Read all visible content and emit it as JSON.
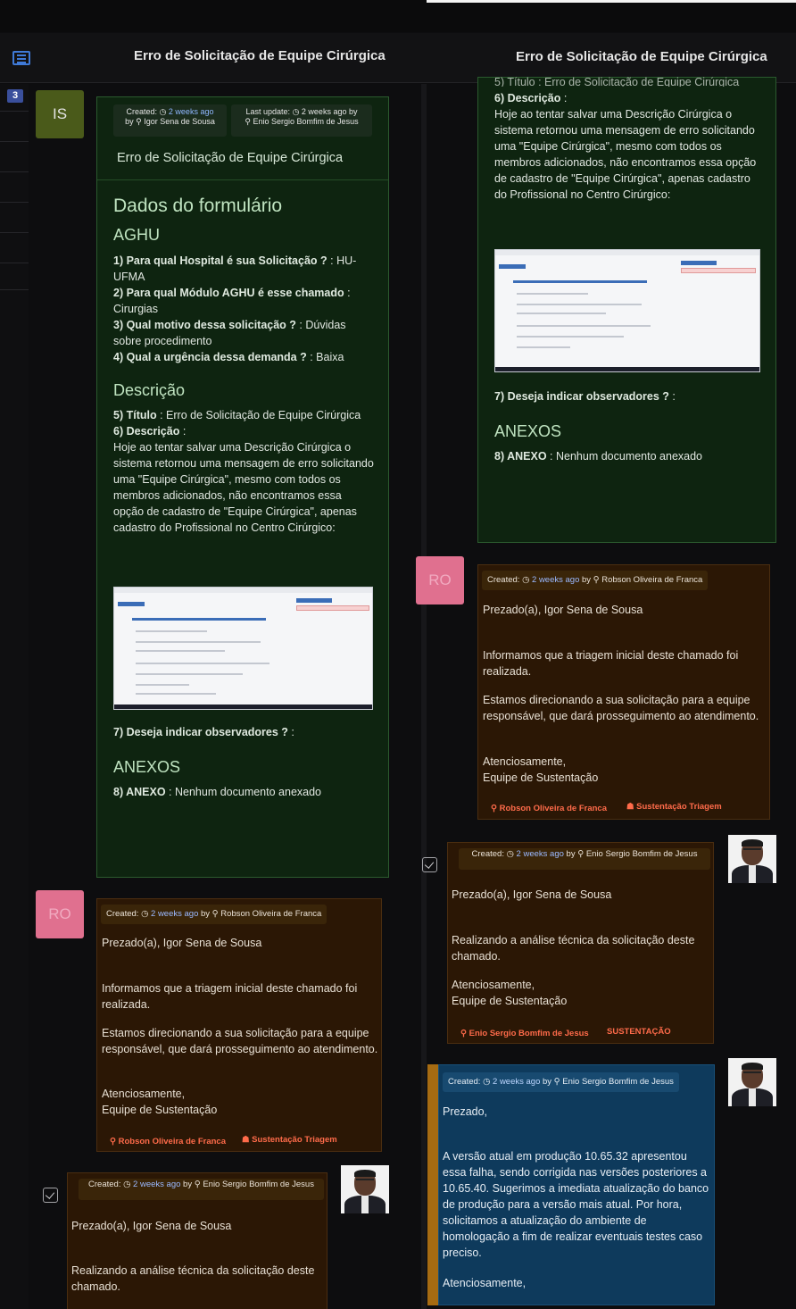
{
  "header": {
    "title_left": "Erro de Solicitação de Equipe Cirúrgica",
    "title_right": "Erro de Solicitação de Equipe Cirúrgica"
  },
  "rail": {
    "badge": "3"
  },
  "ticket": {
    "avatar_initials": "IS",
    "created_label": "Created:",
    "created_time": "2 weeks ago",
    "created_by_prefix": "by",
    "created_by": "Igor Sena de Sousa",
    "last_update_label": "Last update:",
    "last_update_time": "2 weeks ago by",
    "last_update_by": "Enio Sergio Bomfim de Jesus",
    "title": "Erro de Solicitação de Equipe Cirúrgica",
    "form_heading": "Dados do formulário",
    "section_aghu": "AGHU",
    "q1": "1) Para qual Hospital é sua Solicitação ?",
    "a1": " : HU-UFMA",
    "q2": "2) Para qual Módulo AGHU é esse chamado",
    "a2": " : Cirurgias",
    "q3": "3) Qual motivo dessa solicitação ?",
    "a3": " : Dúvidas sobre procedimento",
    "q4": "4) Qual a urgência dessa demanda ?",
    "a4": " : Baixa",
    "section_desc": "Descrição",
    "q5": "5) Título",
    "a5": " : Erro de Solicitação de Equipe Cirúrgica",
    "q6": "6) Descrição",
    "a6_prefix": " :",
    "description": "Hoje ao tentar salvar uma Descrição Cirúrgica o sistema retornou uma mensagem de erro solicitando uma \"Equipe Cirúrgica\", mesmo com todos os membros adicionados, não encontramos essa opção de cadastro de \"Equipe Cirúrgica\", apenas cadastro do Profissional no Centro Cirúrgico:",
    "q7": "7) Deseja indicar observadores ?",
    "a7": " :",
    "section_anexos": "ANEXOS",
    "q8": "8) ANEXO",
    "a8": " : Nenhum documento anexado",
    "partial_top": "5) Título : Erro de Solicitação de Equipe Cirúrgica"
  },
  "reply_triagem": {
    "avatar_initials": "RO",
    "created_label": "Created:",
    "created_time": "2 weeks ago",
    "by": "by",
    "author": "Robson Oliveira de Franca",
    "greeting": "Prezado(a), Igor Sena de Sousa",
    "p1": "Informamos que a triagem inicial deste chamado foi realizada.",
    "p2": "Estamos direcionando a sua solicitação para a equipe responsável, que dará prosseguimento ao atendimento.",
    "p3a": "Atenciosamente,",
    "p3b": "Equipe de Sustentação",
    "footer_name": "Robson Oliveira de Franca",
    "footer_team": "Sustentação Triagem"
  },
  "reply_analise": {
    "created_label": "Created:",
    "created_time": "2 weeks ago",
    "by": "by",
    "author": "Enio Sergio Bomfim de Jesus",
    "greeting": "Prezado(a), Igor Sena de Sousa",
    "p1": "Realizando a análise técnica da solicitação deste chamado.",
    "p2a": "Atenciosamente,",
    "p2b": "Equipe de Sustentação",
    "footer_name": "Enio Sergio Bomfim de Jesus",
    "footer_team": "SUSTENTAÇÃO"
  },
  "reply_versao": {
    "created_label": "Created:",
    "created_time": "2 weeks ago",
    "by": "by",
    "author": "Enio Sergio Bomfim de Jesus",
    "greeting": "Prezado,",
    "p1": "A versão atual em produção 10.65.32 apresentou essa falha, sendo corrigida nas versões posteriores a 10.65.40. Sugerimos a imediata atualização do banco de produção para a versão mais atual. Por hora, solicitamos a atualização do ambiente de homologação a fim de realizar eventuais testes caso preciso.",
    "p2": "Atenciosamente,"
  },
  "colors": {
    "green_card": "#0e2410",
    "brown_card": "#2b1705",
    "blue_card": "#0e3a5c",
    "accent_orange": "#ff6b4a",
    "link_blue": "#8fb7ff"
  }
}
